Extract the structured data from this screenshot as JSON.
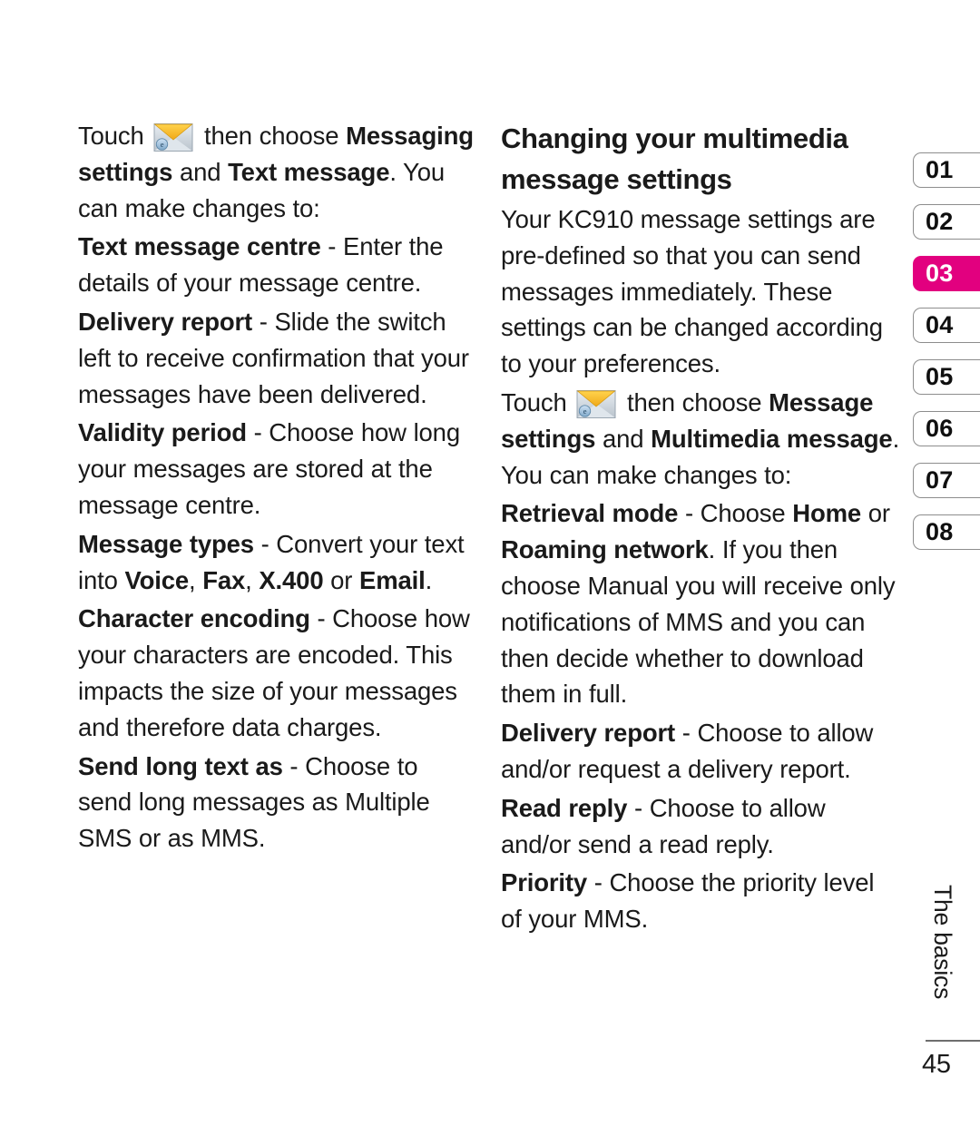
{
  "document": {
    "section_label": "The basics",
    "page_number": "45",
    "accent_color": "#e2007f",
    "text_color": "#1a1a1a"
  },
  "icons": {
    "envelope": "envelope-icon"
  },
  "left_column": {
    "paragraphs": [
      {
        "id": "touch-messaging-settings",
        "runs": [
          {
            "text": "Touch ",
            "bold": false
          },
          {
            "icon": "envelope-icon"
          },
          {
            "text": " then choose ",
            "bold": false
          },
          {
            "text": "Messaging settings",
            "bold": true
          },
          {
            "text": " and ",
            "bold": false
          },
          {
            "text": "Text message",
            "bold": true
          },
          {
            "text": ". You can make changes to:",
            "bold": false
          }
        ]
      },
      {
        "id": "text-message-centre",
        "runs": [
          {
            "text": "Text message centre",
            "bold": true
          },
          {
            "text": " - Enter the details of your message centre.",
            "bold": false
          }
        ]
      },
      {
        "id": "delivery-report-sms",
        "runs": [
          {
            "text": "Delivery report",
            "bold": true
          },
          {
            "text": " - Slide the switch left to receive confirmation that your messages have been delivered.",
            "bold": false
          }
        ]
      },
      {
        "id": "validity-period",
        "runs": [
          {
            "text": "Validity period",
            "bold": true
          },
          {
            "text": " - Choose how long your messages are stored at the message centre.",
            "bold": false
          }
        ]
      },
      {
        "id": "message-types",
        "runs": [
          {
            "text": "Message types",
            "bold": true
          },
          {
            "text": " - Convert your text into ",
            "bold": false
          },
          {
            "text": "Voice",
            "bold": true
          },
          {
            "text": ", ",
            "bold": false
          },
          {
            "text": "Fax",
            "bold": true
          },
          {
            "text": ", ",
            "bold": false
          },
          {
            "text": "X.400",
            "bold": true
          },
          {
            "text": " or ",
            "bold": false
          },
          {
            "text": "Email",
            "bold": true
          },
          {
            "text": ".",
            "bold": false
          }
        ]
      },
      {
        "id": "character-encoding",
        "runs": [
          {
            "text": "Character encoding",
            "bold": true
          },
          {
            "text": " - Choose how your characters are encoded. This impacts the size of your messages and therefore data charges.",
            "bold": false
          }
        ]
      },
      {
        "id": "send-long-text-as",
        "runs": [
          {
            "text": "Send long text as",
            "bold": true
          },
          {
            "text": " - Choose to send long messages as Multiple SMS or as MMS.",
            "bold": false
          }
        ]
      }
    ]
  },
  "right_column": {
    "heading": "Changing your multimedia message settings",
    "paragraphs": [
      {
        "id": "mms-intro",
        "runs": [
          {
            "text": "Your KC910 message settings are pre-defined so that you can send messages immediately. These settings can be changed according to your preferences.",
            "bold": false
          }
        ]
      },
      {
        "id": "touch-message-settings",
        "runs": [
          {
            "text": "Touch ",
            "bold": false
          },
          {
            "icon": "envelope-icon"
          },
          {
            "text": " then choose ",
            "bold": false
          },
          {
            "text": "Message settings",
            "bold": true
          },
          {
            "text": " and ",
            "bold": false
          },
          {
            "text": "Multimedia message",
            "bold": true
          },
          {
            "text": ". You can make changes to:",
            "bold": false
          }
        ]
      },
      {
        "id": "retrieval-mode",
        "runs": [
          {
            "text": "Retrieval mode",
            "bold": true
          },
          {
            "text": " - Choose ",
            "bold": false
          },
          {
            "text": "Home",
            "bold": true
          },
          {
            "text": " or ",
            "bold": false
          },
          {
            "text": "Roaming network",
            "bold": true
          },
          {
            "text": ". If you then choose Manual you will receive only notifications of MMS and you can then decide whether to download them in full.",
            "bold": false
          }
        ]
      },
      {
        "id": "delivery-report-mms",
        "runs": [
          {
            "text": "Delivery report",
            "bold": true
          },
          {
            "text": " - Choose to allow and/or request a delivery report.",
            "bold": false
          }
        ]
      },
      {
        "id": "read-reply",
        "runs": [
          {
            "text": "Read reply",
            "bold": true
          },
          {
            "text": " - Choose to allow and/or send a read reply.",
            "bold": false
          }
        ]
      },
      {
        "id": "priority",
        "runs": [
          {
            "text": "Priority",
            "bold": true
          },
          {
            "text": " - Choose the priority level of your MMS.",
            "bold": false
          }
        ]
      }
    ]
  },
  "tabs": {
    "active_index": 2,
    "items": [
      {
        "label": "01"
      },
      {
        "label": "02"
      },
      {
        "label": "03"
      },
      {
        "label": "04"
      },
      {
        "label": "05"
      },
      {
        "label": "06"
      },
      {
        "label": "07"
      },
      {
        "label": "08"
      }
    ]
  }
}
